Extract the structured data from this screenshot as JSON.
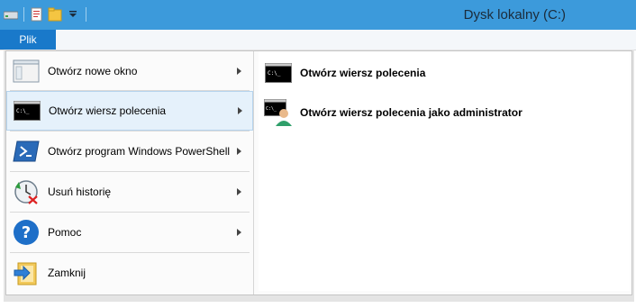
{
  "window": {
    "title": "Dysk lokalny (C:)"
  },
  "quick_access": [
    "drive-icon",
    "properties-icon",
    "new-folder-icon",
    "customize-dropdown-icon"
  ],
  "ribbon": {
    "file_tab": "Plik"
  },
  "file_menu": {
    "items": [
      {
        "label": "Otwórz nowe okno",
        "icon": "window-icon",
        "has_submenu": true
      },
      {
        "label": "Otwórz wiersz polecenia",
        "icon": "cmd-icon",
        "has_submenu": true,
        "active": true
      },
      {
        "label": "Otwórz program Windows PowerShell",
        "icon": "powershell-icon",
        "has_submenu": true
      },
      {
        "label": "Usuń historię",
        "icon": "clear-history-icon",
        "has_submenu": true
      },
      {
        "label": "Pomoc",
        "icon": "help-icon",
        "has_submenu": true
      },
      {
        "label": "Zamknij",
        "icon": "close-folder-icon",
        "has_submenu": false
      }
    ],
    "submenu": [
      {
        "label": "Otwórz wiersz polecenia",
        "icon": "cmd-icon"
      },
      {
        "label": "Otwórz wiersz polecenia jako administrator",
        "icon": "cmd-admin-icon"
      }
    ]
  },
  "colors": {
    "titlebar": "#3c9adb",
    "file_tab": "#1979ca",
    "active_item": "#e5f1fb"
  }
}
